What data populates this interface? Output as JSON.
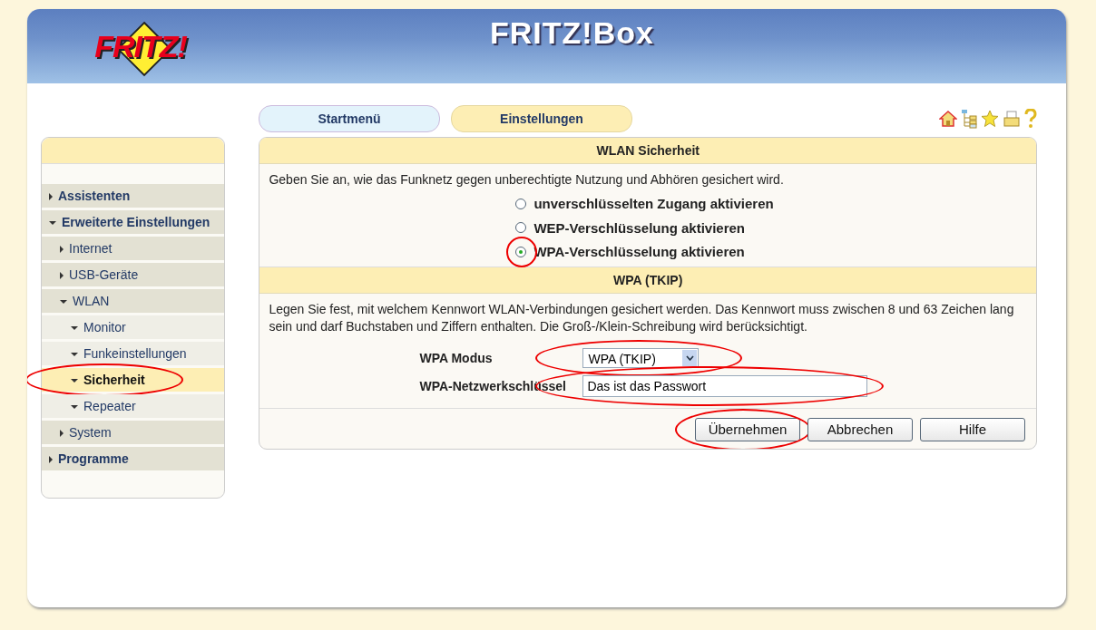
{
  "header": {
    "logo": "FRITZ!",
    "title": "FRITZ!Box"
  },
  "tabs": [
    {
      "label": "Startmenü",
      "selected": false
    },
    {
      "label": "Einstellungen",
      "selected": true
    }
  ],
  "sidebar": {
    "items": [
      {
        "label": "Assistenten",
        "expanded": false,
        "selected": false
      },
      {
        "label": "Erweiterte Einstellungen",
        "expanded": true,
        "selected": false,
        "children": [
          {
            "label": "Internet",
            "expanded": false,
            "selected": false
          },
          {
            "label": "USB-Geräte",
            "expanded": false,
            "selected": false
          },
          {
            "label": "WLAN",
            "expanded": true,
            "selected": false,
            "children": [
              {
                "label": "Monitor",
                "expanded": true,
                "selected": false
              },
              {
                "label": "Funkeinstellungen",
                "expanded": true,
                "selected": false
              },
              {
                "label": "Sicherheit",
                "expanded": true,
                "selected": true,
                "annotated": true
              },
              {
                "label": "Repeater",
                "expanded": true,
                "selected": false
              }
            ]
          },
          {
            "label": "System",
            "expanded": false,
            "selected": false
          }
        ]
      },
      {
        "label": "Programme",
        "expanded": false,
        "selected": false
      }
    ]
  },
  "security": {
    "title": "WLAN Sicherheit",
    "intro": "Geben Sie an, wie das Funknetz gegen unberechtigte Nutzung und Abhören gesichert wird.",
    "options": [
      {
        "label": "unverschlüsselten Zugang aktivieren",
        "selected": false,
        "annotated": false
      },
      {
        "label": "WEP-Verschlüsselung aktivieren",
        "selected": false,
        "annotated": false
      },
      {
        "label": "WPA-Verschlüsselung aktivieren",
        "selected": true,
        "annotated": true
      }
    ]
  },
  "wpa": {
    "title": "WPA (TKIP)",
    "intro": "Legen Sie fest, mit welchem Kennwort WLAN-Verbindungen gesichert werden. Das Kennwort muss zwischen 8 und 63 Zeichen lang sein und darf Buchstaben und Ziffern enthalten. Die Groß-/Klein-Schreibung wird berücksichtigt.",
    "mode": {
      "label": "WPA Modus",
      "value": "WPA (TKIP)",
      "annotated": true
    },
    "key": {
      "label": "WPA-Netzwerkschlüssel",
      "value": "Das ist das Passwort",
      "annotated": true
    }
  },
  "buttons": [
    {
      "label": "Übernehmen",
      "annotated": true
    },
    {
      "label": "Abbrechen",
      "annotated": false
    },
    {
      "label": "Hilfe",
      "annotated": false
    }
  ]
}
